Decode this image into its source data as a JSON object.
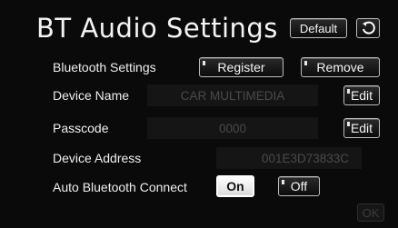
{
  "screen": {
    "title": "BT Audio Settings"
  },
  "header": {
    "default_label": "Default",
    "back_icon": "back-arrow-icon"
  },
  "rows": {
    "bluetooth_settings": {
      "label": "Bluetooth Settings",
      "register_label": "Register",
      "remove_label": "Remove"
    },
    "device_name": {
      "label": "Device Name",
      "value": "CAR MULTIMEDIA",
      "edit_label": "Edit"
    },
    "passcode": {
      "label": "Passcode",
      "value": "0000",
      "edit_label": "Edit"
    },
    "device_address": {
      "label": "Device Address",
      "value": "001E3D73833C"
    },
    "auto_connect": {
      "label": "Auto Bluetooth Connect",
      "on_label": "On",
      "off_label": "Off",
      "selected": "On"
    }
  },
  "footer": {
    "ok_label": "OK"
  }
}
